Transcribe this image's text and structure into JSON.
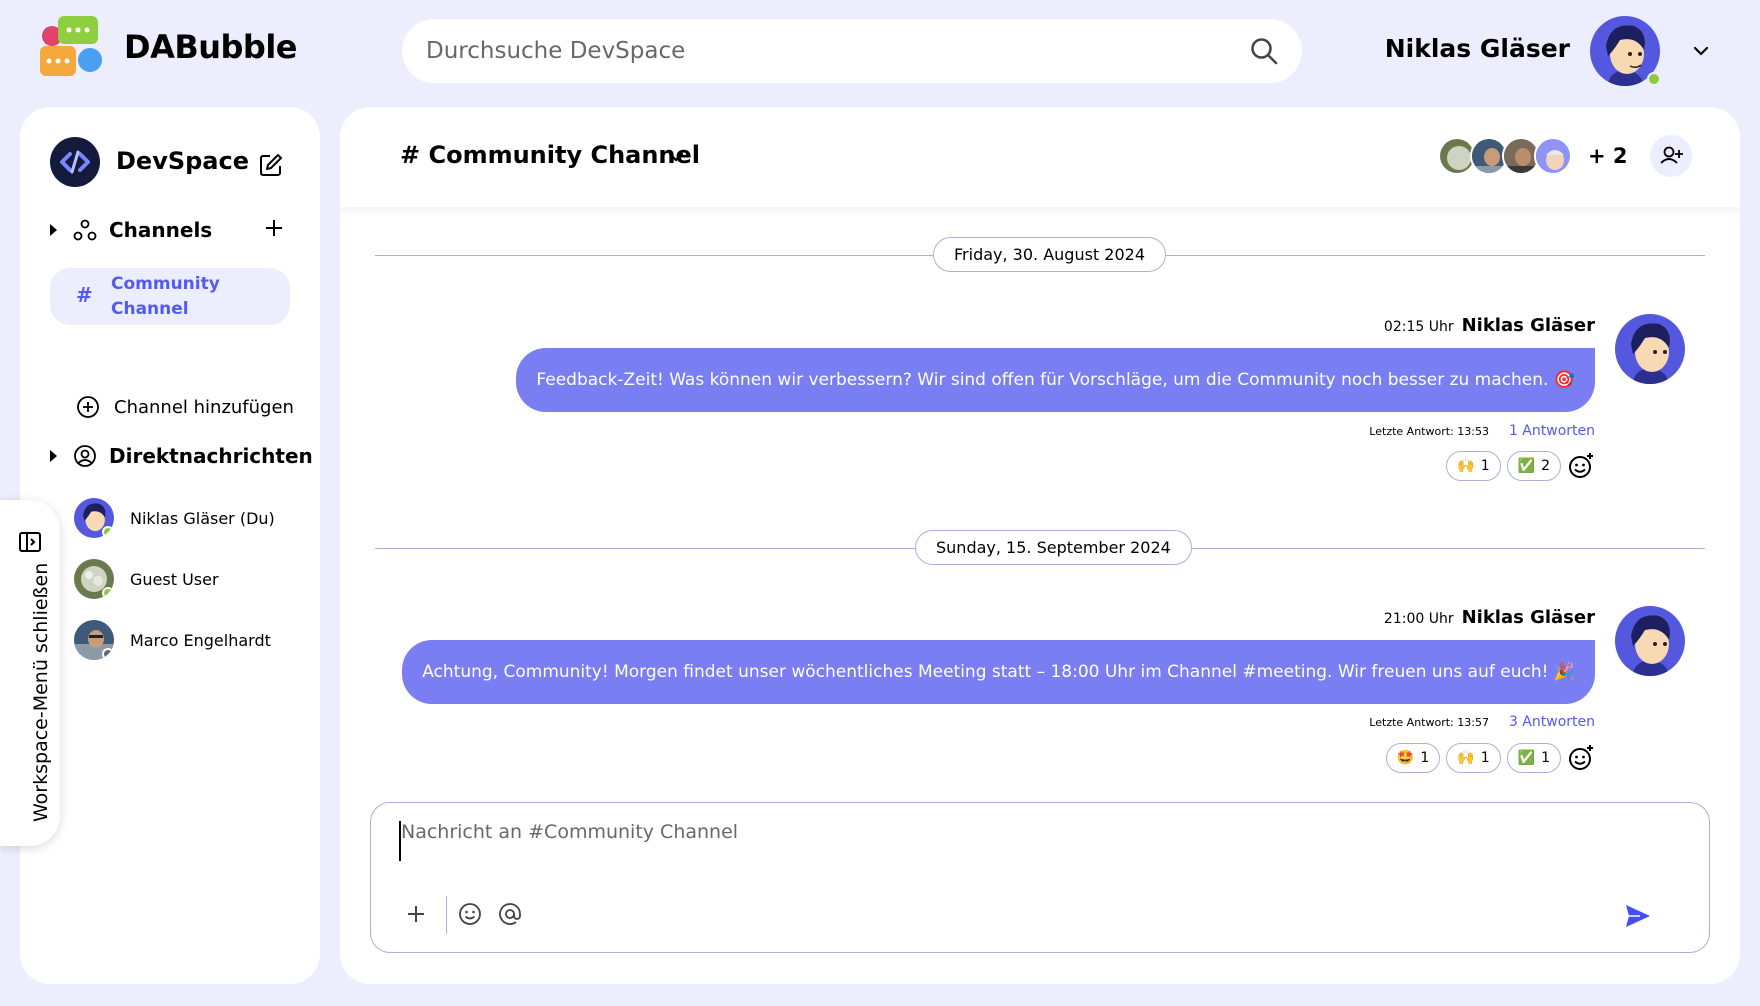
{
  "app": {
    "name": "DABubble"
  },
  "search": {
    "placeholder": "Durchsuche DevSpace"
  },
  "user": {
    "name": "Niklas Gläser",
    "status": "online"
  },
  "sidebar": {
    "workspace_name": "DevSpace",
    "channels_title": "Channels",
    "channels": [
      {
        "label": "Community Channel",
        "active": true
      }
    ],
    "add_channel_label": "Channel hinzufügen",
    "dm_title": "Direktnachrichten",
    "dms": [
      {
        "name": "Niklas Gläser (Du)",
        "status": "online"
      },
      {
        "name": "Guest User",
        "status": "online"
      },
      {
        "name": "Marco Engelhardt",
        "status": "offline"
      }
    ]
  },
  "workspace_tab": {
    "label": "Workspace-Menü schließen"
  },
  "channel": {
    "title": "# Community Channel",
    "extra_members": "+ 2"
  },
  "messages": [
    {
      "date": "Friday, 30. August 2024",
      "time": "02:15 Uhr",
      "author": "Niklas Gläser",
      "text": "Feedback-Zeit! Was können wir verbessern? Wir sind offen für Vorschläge, um die Community noch besser zu machen. 🎯",
      "last_reply": "Letzte Antwort: 13:53",
      "replies": "1 Antworten",
      "reactions": [
        {
          "emoji": "🙌",
          "count": "1"
        },
        {
          "emoji": "✅",
          "count": "2"
        }
      ]
    },
    {
      "date": "Sunday, 15. September 2024",
      "time": "21:00 Uhr",
      "author": "Niklas Gläser",
      "text": "Achtung, Community! Morgen findet unser wöchentliches Meeting statt – 18:00 Uhr im Channel #meeting. Wir freuen uns auf euch! 🎉",
      "last_reply": "Letzte Antwort: 13:57",
      "replies": "3 Antworten",
      "reactions": [
        {
          "emoji": "🤩",
          "count": "1"
        },
        {
          "emoji": "🙌",
          "count": "1"
        },
        {
          "emoji": "✅",
          "count": "1"
        }
      ]
    }
  ],
  "composer": {
    "placeholder": "Nachricht an #Community Channel"
  },
  "colors": {
    "accent": "#535af1",
    "bubble": "#797ef3",
    "background": "#eceefe",
    "online": "#92c83e"
  }
}
